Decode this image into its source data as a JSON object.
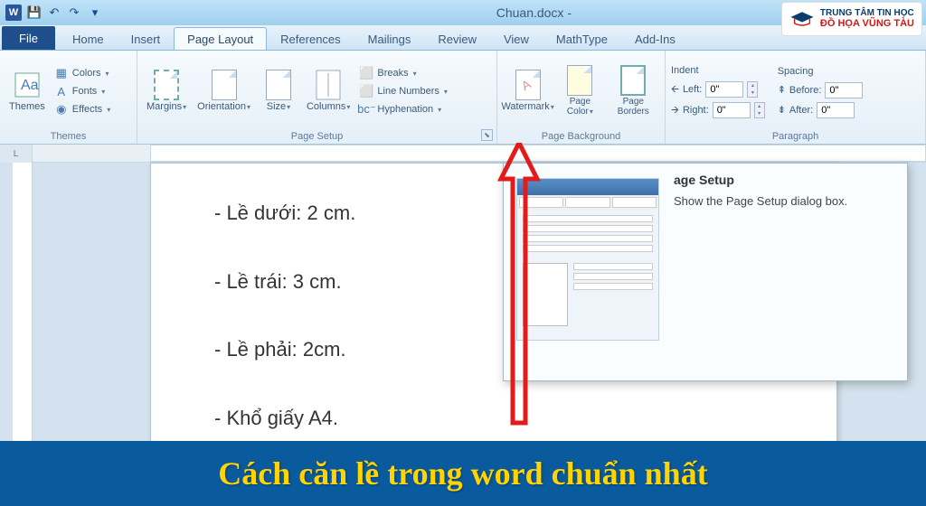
{
  "title": "Chuan.docx -",
  "logo": {
    "line1": "TRUNG TÂM TIN HỌC",
    "line2": "ĐỒ HỌA VŨNG TÀU"
  },
  "tabs": {
    "file": "File",
    "items": [
      "Home",
      "Insert",
      "Page Layout",
      "References",
      "Mailings",
      "Review",
      "View",
      "MathType",
      "Add-Ins"
    ],
    "active_index": 2
  },
  "ribbon": {
    "themes": {
      "label": "Themes",
      "themes_btn": "Themes",
      "colors": "Colors",
      "fonts": "Fonts",
      "effects": "Effects"
    },
    "page_setup": {
      "label": "Page Setup",
      "margins": "Margins",
      "orientation": "Orientation",
      "size": "Size",
      "columns": "Columns",
      "breaks": "Breaks",
      "line_numbers": "Line Numbers",
      "hyphenation": "Hyphenation"
    },
    "page_bg": {
      "label": "Page Background",
      "watermark": "Watermark",
      "page_color": "Page Color",
      "page_borders": "Page Borders"
    },
    "paragraph": {
      "label": "Paragraph",
      "indent": "Indent",
      "left": "Left:",
      "right": "Right:",
      "spacing": "Spacing",
      "before": "Before:",
      "after": "After:",
      "zero": "0\""
    }
  },
  "tooltip": {
    "title": "age Setup",
    "body": "Show the Page Setup dialog box."
  },
  "document": {
    "lines": [
      "- Lề dưới: 2 cm.",
      "- Lề trái: 3 cm.",
      "- Lề phải: 2cm.",
      "- Khổ giấy A4."
    ]
  },
  "banner": "Cách căn lề trong word chuẩn nhất",
  "ruler_corner": "L"
}
